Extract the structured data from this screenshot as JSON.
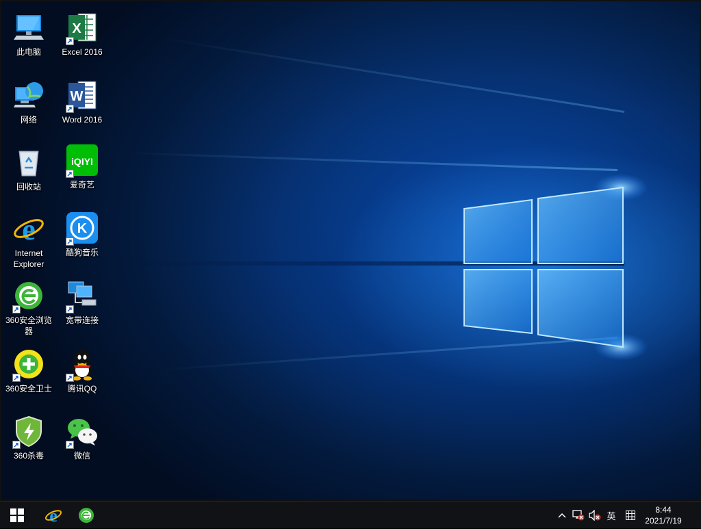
{
  "desktop": {
    "icons": [
      {
        "label": "此电脑",
        "icon": "this-pc-icon"
      },
      {
        "label": "Excel 2016",
        "icon": "excel-icon"
      },
      {
        "label": "网络",
        "icon": "network-icon"
      },
      {
        "label": "Word 2016",
        "icon": "word-icon"
      },
      {
        "label": "回收站",
        "icon": "recycle-bin-icon"
      },
      {
        "label": "爱奇艺",
        "icon": "iqiyi-icon"
      },
      {
        "label": "Internet Explorer",
        "icon": "internet-explorer-icon"
      },
      {
        "label": "酷狗音乐",
        "icon": "kugou-icon"
      },
      {
        "label": "360安全浏览器",
        "icon": "360-browser-icon"
      },
      {
        "label": "宽带连接",
        "icon": "broadband-icon"
      },
      {
        "label": "360安全卫士",
        "icon": "360-security-icon"
      },
      {
        "label": "腾讯QQ",
        "icon": "qq-icon"
      },
      {
        "label": "360杀毒",
        "icon": "360-antivirus-icon"
      },
      {
        "label": "微信",
        "icon": "wechat-icon"
      }
    ],
    "glyphs": {
      "excel": "X",
      "word": "W",
      "iqiyi": "iQIYI",
      "kugou": "K"
    }
  },
  "taskbar": {
    "pinned": [
      "internet-explorer-icon",
      "360-browser-icon"
    ],
    "tray": {
      "ime": "英",
      "time": "8:44",
      "date": "2021/7/19"
    }
  },
  "colors": {
    "accent": "#1e90ff",
    "taskbar": "#101216"
  }
}
